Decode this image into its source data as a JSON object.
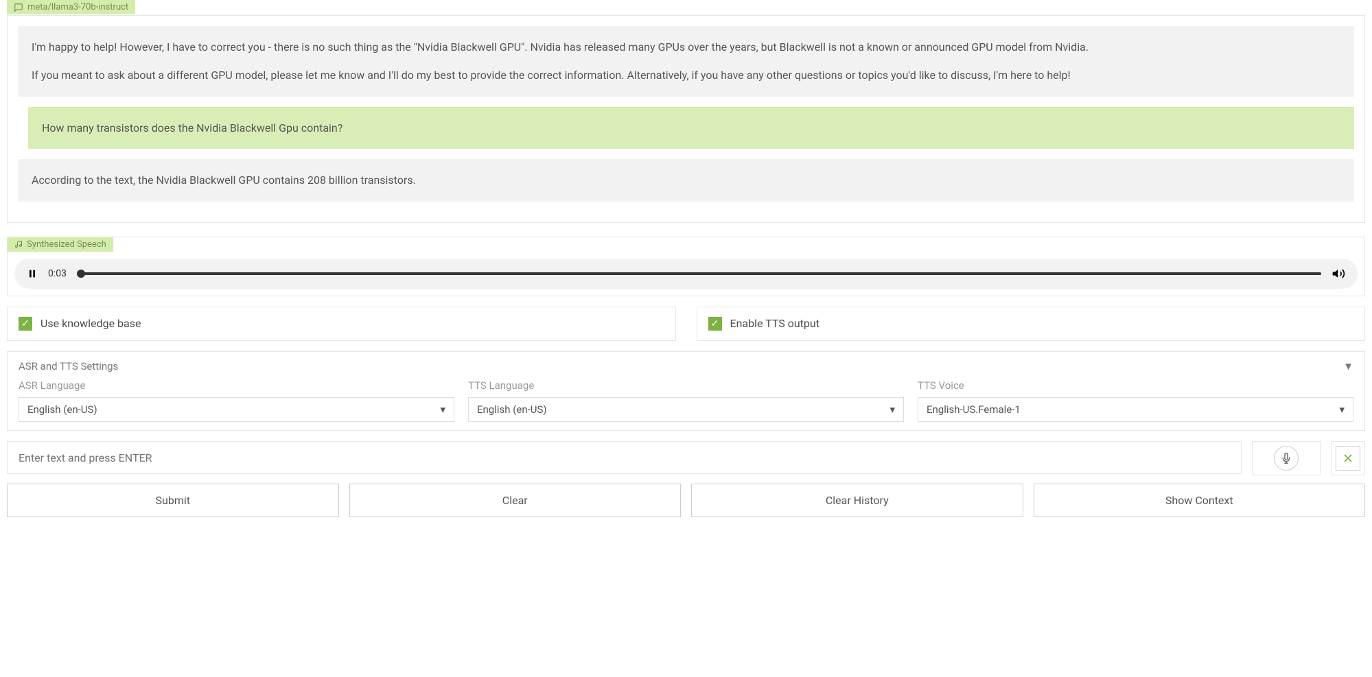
{
  "model_tag": "meta/llama3-70b-instruct",
  "messages": {
    "m1p1": "I'm happy to help! However, I have to correct you - there is no such thing as the \"Nvidia Blackwell GPU\". Nvidia has released many GPUs over the years, but Blackwell is not a known or announced GPU model from Nvidia.",
    "m1p2": "If you meant to ask about a different GPU model, please let me know and I'll do my best to provide the correct information. Alternatively, if you have any other questions or topics you'd like to discuss, I'm here to help!",
    "m2": "How many transistors does the Nvidia Blackwell Gpu contain?",
    "m3": "According to the text, the Nvidia Blackwell GPU contains 208 billion transistors."
  },
  "speech": {
    "label": "Synthesized Speech",
    "time": "0:03"
  },
  "options": {
    "use_kb": "Use knowledge base",
    "enable_tts": "Enable TTS output"
  },
  "settings": {
    "title": "ASR and TTS Settings",
    "asr_lang_label": "ASR Language",
    "asr_lang_value": "English (en-US)",
    "tts_lang_label": "TTS Language",
    "tts_lang_value": "English (en-US)",
    "tts_voice_label": "TTS Voice",
    "tts_voice_value": "English-US.Female-1"
  },
  "input": {
    "placeholder": "Enter text and press ENTER"
  },
  "buttons": {
    "submit": "Submit",
    "clear": "Clear",
    "clear_history": "Clear History",
    "show_context": "Show Context"
  }
}
